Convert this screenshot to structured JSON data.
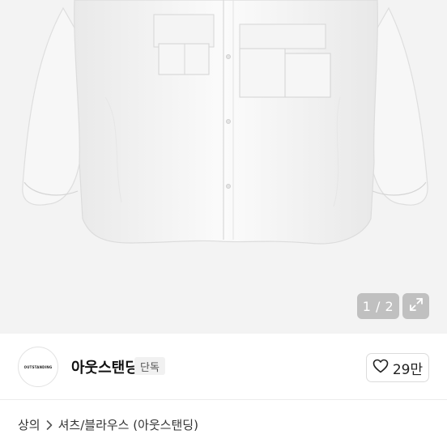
{
  "gallery": {
    "counter": "1 / 2",
    "image_alt": "white shirt product photo"
  },
  "shop": {
    "logo_text": "OUTSTANDING",
    "name": "아웃스탠딩",
    "badge": "단독",
    "likes": "29만"
  },
  "breadcrumb": {
    "category": "상의",
    "subcategory": "셔츠/블라우스 (아웃스탠딩)"
  },
  "icons": {
    "expand": "expand-icon",
    "heart": "heart-outline-icon",
    "chevron": "chevron-right-icon"
  }
}
